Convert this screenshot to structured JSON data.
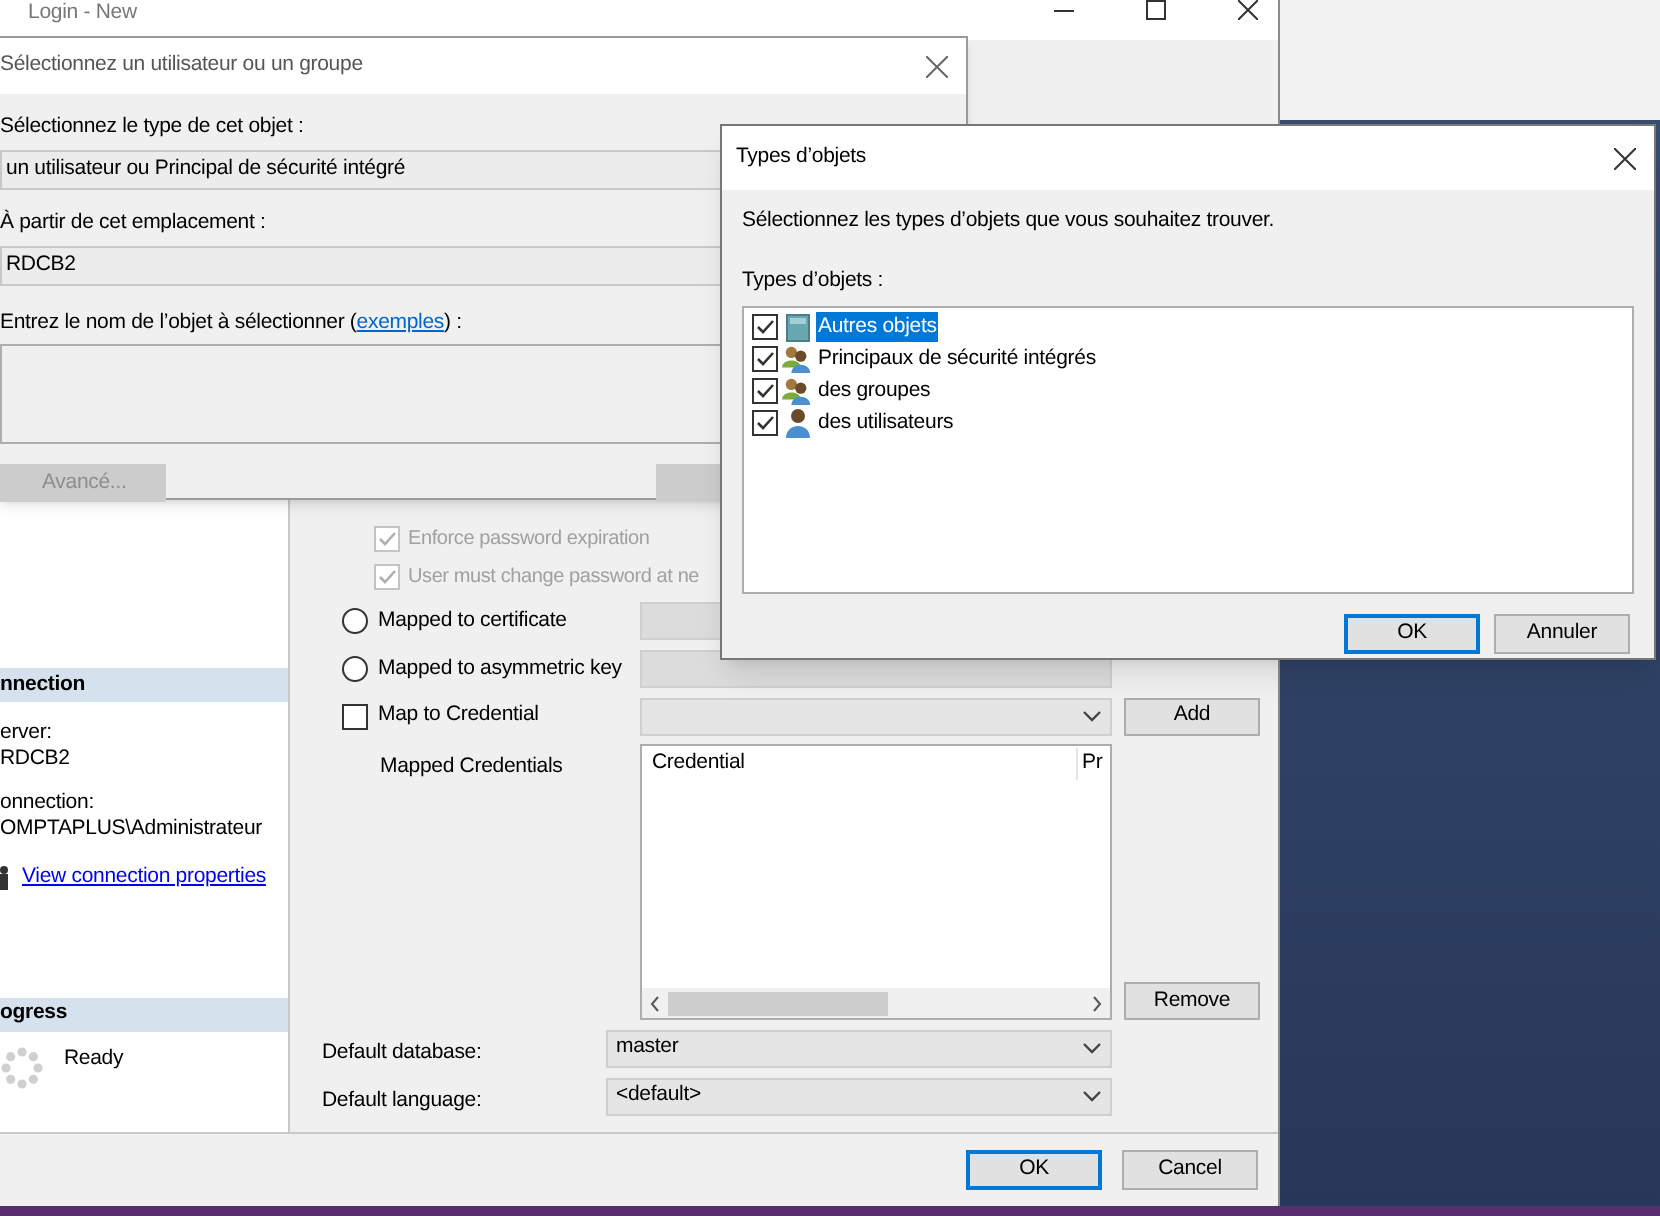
{
  "main_window": {
    "title": "Login - New",
    "connection": {
      "header": "nnection",
      "lines": [
        "erver:",
        "RDCB2",
        "onnection:",
        "OMPTAPLUS\\Administrateur"
      ],
      "link": "View connection properties"
    },
    "progress": {
      "header": "ogress",
      "status": "Ready"
    },
    "password_options": [
      {
        "label": "Enforce password expiration",
        "checked": true,
        "disabled": true
      },
      {
        "label": "User must change password at ne",
        "checked": true,
        "disabled": true
      }
    ],
    "mappings": [
      {
        "label": "Mapped to certificate",
        "selected": false
      },
      {
        "label": "Mapped to asymmetric key",
        "selected": false
      }
    ],
    "map_to_credential": {
      "label": "Map to Credential",
      "checked": false
    },
    "add_button": "Add",
    "mapped_credentials": {
      "label": "Mapped Credentials",
      "columns": [
        "Credential",
        "Pr"
      ]
    },
    "remove_button": "Remove",
    "defaults": [
      {
        "label": "Default database:",
        "value": "master"
      },
      {
        "label": "Default language:",
        "value": "<default>"
      }
    ],
    "buttons": [
      {
        "label": "OK",
        "default": true
      },
      {
        "label": "Cancel",
        "default": false
      }
    ]
  },
  "select_dialog": {
    "title": "Sélectionnez un utilisateur ou un groupe",
    "fields": [
      {
        "label": "Sélectionnez le type de cet objet :",
        "value": "un utilisateur ou Principal de sécurité intégré"
      },
      {
        "label": "À partir de cet emplacement :",
        "value": "RDCB2"
      }
    ],
    "name_entry": {
      "before": "Entrez le nom de l’objet à sélectionner (",
      "link": "exemples",
      "after": ") :"
    },
    "buttons": [
      {
        "label": "Avancé...",
        "disabled": true
      },
      {
        "disabled": true
      }
    ]
  },
  "types_dialog": {
    "title": "Types d’objets",
    "prompt": "Sélectionnez les types d’objets que vous souhaitez trouver.",
    "list_label": "Types d’objets :",
    "items": [
      {
        "kind": "container",
        "label": "Autres objets",
        "checked": true,
        "selected": true
      },
      {
        "kind": "group",
        "label": "Principaux de sécurité intégrés",
        "checked": true,
        "selected": false
      },
      {
        "kind": "group",
        "label": "des groupes",
        "checked": true,
        "selected": false
      },
      {
        "kind": "user",
        "label": "des utilisateurs",
        "checked": true,
        "selected": false
      }
    ],
    "buttons": [
      {
        "label": "OK",
        "default": true
      },
      {
        "label": "Annuler",
        "default": false
      }
    ]
  }
}
